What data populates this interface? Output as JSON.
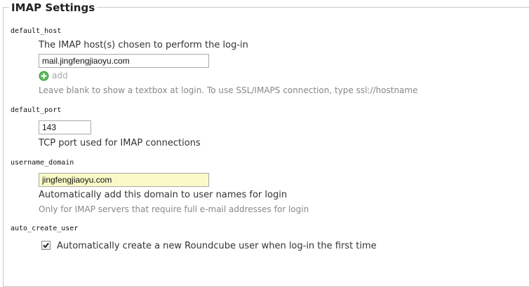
{
  "section": {
    "title": "IMAP Settings"
  },
  "default_host": {
    "key": "default_host",
    "description": "The IMAP host(s) chosen to perform the log-in",
    "value": "mail.jingfengjiaoyu.com",
    "add_label": "add",
    "hint": "Leave blank to show a textbox at login. To use SSL/IMAPS connection, type ssl://hostname"
  },
  "default_port": {
    "key": "default_port",
    "value": "143",
    "description": "TCP port used for IMAP connections"
  },
  "username_domain": {
    "key": "username_domain",
    "value": "jingfengjiaoyu.com",
    "description": "Automatically add this domain to user names for login",
    "hint": "Only for IMAP servers that require full e-mail addresses for login"
  },
  "auto_create_user": {
    "key": "auto_create_user",
    "checked": true,
    "label": "Automatically create a new Roundcube user when log-in the first time"
  },
  "colors": {
    "autofill_bg": "#fafac8",
    "add_icon": "#5cb85c",
    "hint_text": "#888888"
  }
}
